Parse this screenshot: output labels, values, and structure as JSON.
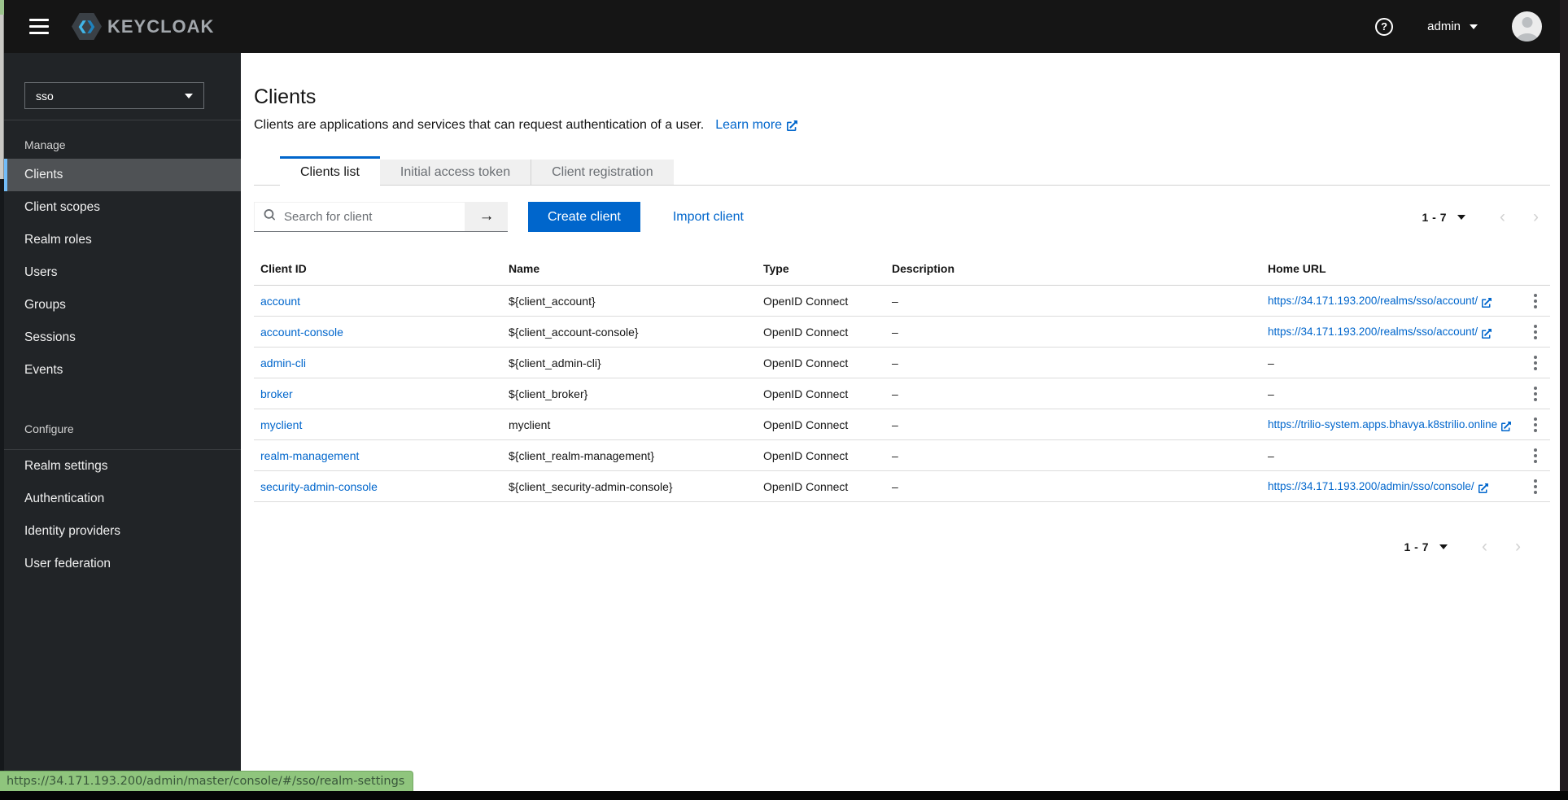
{
  "header": {
    "brand": "KEYCLOAK",
    "user": "admin"
  },
  "sidebar": {
    "realm": "sso",
    "sections": [
      {
        "label": "Manage",
        "items": [
          {
            "label": "Clients",
            "active": true
          },
          {
            "label": "Client scopes"
          },
          {
            "label": "Realm roles"
          },
          {
            "label": "Users"
          },
          {
            "label": "Groups"
          },
          {
            "label": "Sessions"
          },
          {
            "label": "Events"
          }
        ]
      },
      {
        "label": "Configure",
        "items": [
          {
            "label": "Realm settings"
          },
          {
            "label": "Authentication"
          },
          {
            "label": "Identity providers"
          },
          {
            "label": "User federation"
          }
        ]
      }
    ]
  },
  "main": {
    "title": "Clients",
    "description": "Clients are applications and services that can request authentication of a user.",
    "learn_more_label": "Learn more",
    "tabs": [
      {
        "label": "Clients list",
        "active": true
      },
      {
        "label": "Initial access token",
        "active": false
      },
      {
        "label": "Client registration",
        "active": false
      }
    ],
    "toolbar": {
      "search_placeholder": "Search for client",
      "create_label": "Create client",
      "import_label": "Import client"
    },
    "pagination": {
      "range": "1 - 7"
    },
    "table": {
      "columns": [
        "Client ID",
        "Name",
        "Type",
        "Description",
        "Home URL"
      ],
      "empty_value": "–",
      "rows": [
        {
          "client_id": "account",
          "name": "${client_account}",
          "type": "OpenID Connect",
          "description": "–",
          "home_url": "https://34.171.193.200/realms/sso/account/"
        },
        {
          "client_id": "account-console",
          "name": "${client_account-console}",
          "type": "OpenID Connect",
          "description": "–",
          "home_url": "https://34.171.193.200/realms/sso/account/"
        },
        {
          "client_id": "admin-cli",
          "name": "${client_admin-cli}",
          "type": "OpenID Connect",
          "description": "–",
          "home_url": "–"
        },
        {
          "client_id": "broker",
          "name": "${client_broker}",
          "type": "OpenID Connect",
          "description": "–",
          "home_url": "–"
        },
        {
          "client_id": "myclient",
          "name": "myclient",
          "type": "OpenID Connect",
          "description": "–",
          "home_url": "https://trilio-system.apps.bhavya.k8strilio.online"
        },
        {
          "client_id": "realm-management",
          "name": "${client_realm-management}",
          "type": "OpenID Connect",
          "description": "–",
          "home_url": "–"
        },
        {
          "client_id": "security-admin-console",
          "name": "${client_security-admin-console}",
          "type": "OpenID Connect",
          "description": "–",
          "home_url": "https://34.171.193.200/admin/sso/console/"
        }
      ]
    }
  },
  "statusbar": {
    "url": "https://34.171.193.200/admin/master/console/#/sso/realm-settings"
  },
  "colors": {
    "accent": "#0066cc",
    "nav_active_indicator": "#73bcf7",
    "header_bg": "#151515",
    "sidebar_bg": "#212427",
    "status_tooltip_bg": "#8fc57d"
  }
}
